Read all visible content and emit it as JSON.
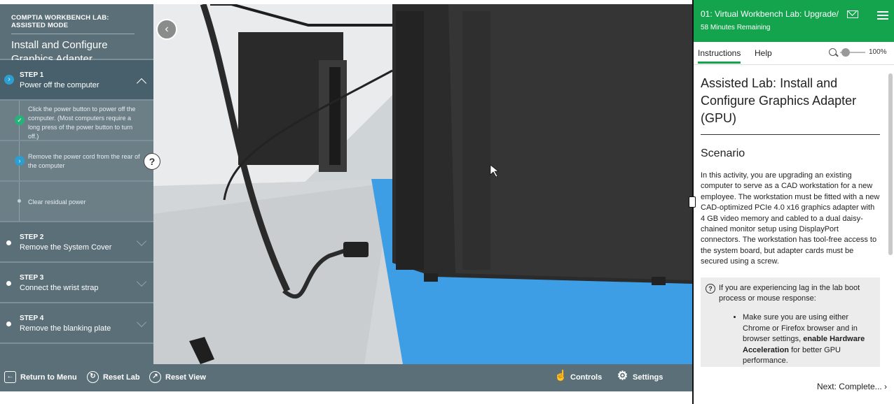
{
  "lab": {
    "mode": "COMPTIA WORKBENCH LAB: ASSISTED MODE",
    "title": "Install and Configure Graphics Adapter",
    "steps": [
      {
        "number": "STEP 1",
        "name": "Power off the computer"
      },
      {
        "number": "STEP 2",
        "name": "Remove the System Cover"
      },
      {
        "number": "STEP 3",
        "name": "Connect the wrist strap"
      },
      {
        "number": "STEP 4",
        "name": "Remove the blanking plate"
      }
    ],
    "substeps": [
      "Click the power button to power off the computer. (Most computers require a long press of the power button to turn off.)",
      "Remove the power cord from the rear of the computer",
      "Clear residual power"
    ],
    "help_symbol": "?"
  },
  "toolbar": {
    "return": "Return to Menu",
    "reset_lab": "Reset Lab",
    "reset_view": "Reset View",
    "controls": "Controls",
    "settings": "Settings"
  },
  "panel": {
    "title": "01: Virtual Workbench Lab: Upgrade/",
    "time": "58 Minutes Remaining",
    "tabs": [
      "Instructions",
      "Help"
    ],
    "zoom": "100%",
    "heading": "Assisted Lab: Install and Configure Graphics Adapter (GPU)",
    "scenario_heading": "Scenario",
    "scenario": "In this activity, you are upgrading an existing computer to serve as a CAD workstation for a new employee. The workstation must be fitted with a new CAD-optimized PCIe 4.0 x16 graphics adapter with 4 GB video memory and cabled to a dual daisy-chained monitor setup using DisplayPort connectors. The workstation has tool-free access to the system board, but adapter cards must be secured using a screw.",
    "note_intro": "If you are experiencing lag in the lab boot process or mouse response:",
    "note_bullet_a": "Make sure you are using either Chrome or Firefox browser and in browser settings, ",
    "note_bullet_bold": "enable Hardware Acceleration",
    "note_bullet_b": " for better GPU performance.",
    "next": "Next: Complete..."
  },
  "colors": {
    "accent": "#14a44d",
    "panel": "#5b6f78",
    "step_icon": "#2a9fd0",
    "check": "#26b37a"
  }
}
